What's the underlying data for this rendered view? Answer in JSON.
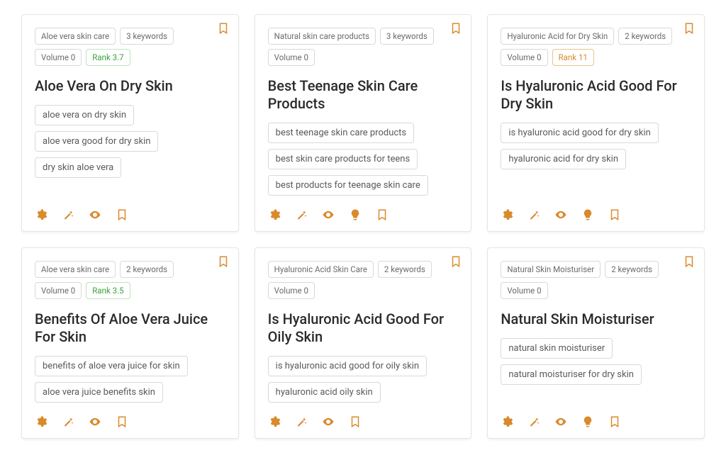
{
  "colors": {
    "accent": "#d98a2b"
  },
  "cards": [
    {
      "meta": [
        "Aloe vera skin care",
        "3 keywords",
        "Volume 0"
      ],
      "rank": {
        "label": "Rank 3.7",
        "tone": "green"
      },
      "title": "Aloe Vera On Dry Skin",
      "keywords": [
        "aloe vera on dry skin",
        "aloe vera good for dry skin",
        "dry skin aloe vera"
      ],
      "actions": [
        "gear",
        "wand",
        "eye",
        "bookmark"
      ]
    },
    {
      "meta": [
        "Natural skin care products",
        "3 keywords",
        "Volume 0"
      ],
      "rank": null,
      "title": "Best Teenage Skin Care Products",
      "keywords": [
        "best teenage skin care products",
        "best skin care products for teens",
        "best products for teenage skin care"
      ],
      "actions": [
        "gear",
        "wand",
        "eye",
        "bulb",
        "bookmark"
      ]
    },
    {
      "meta": [
        "Hyaluronic Acid for Dry Skin",
        "2 keywords",
        "Volume 0"
      ],
      "rank": {
        "label": "Rank 11",
        "tone": "orange"
      },
      "title": "Is Hyaluronic Acid Good For Dry Skin",
      "keywords": [
        "is hyaluronic acid good for dry skin",
        "hyaluronic acid for dry skin"
      ],
      "actions": [
        "gear",
        "wand",
        "eye",
        "bulb",
        "bookmark"
      ]
    },
    {
      "meta": [
        "Aloe vera skin care",
        "2 keywords",
        "Volume 0"
      ],
      "rank": {
        "label": "Rank 3.5",
        "tone": "green"
      },
      "title": "Benefits Of Aloe Vera Juice For Skin",
      "keywords": [
        "benefits of aloe vera juice for skin",
        "aloe vera juice benefits skin"
      ],
      "actions": [
        "gear",
        "wand",
        "eye",
        "bookmark"
      ]
    },
    {
      "meta": [
        "Hyaluronic Acid Skin Care",
        "2 keywords",
        "Volume 0"
      ],
      "rank": null,
      "title": "Is Hyaluronic Acid Good For Oily Skin",
      "keywords": [
        "is hyaluronic acid good for oily skin",
        "hyaluronic acid oily skin"
      ],
      "actions": [
        "gear",
        "wand",
        "eye",
        "bookmark"
      ]
    },
    {
      "meta": [
        "Natural Skin Moisturiser",
        "2 keywords",
        "Volume 0"
      ],
      "rank": null,
      "title": "Natural Skin Moisturiser",
      "keywords": [
        "natural skin moisturiser",
        "natural moisturiser for dry skin"
      ],
      "actions": [
        "gear",
        "wand",
        "eye",
        "bulb",
        "bookmark"
      ]
    }
  ]
}
